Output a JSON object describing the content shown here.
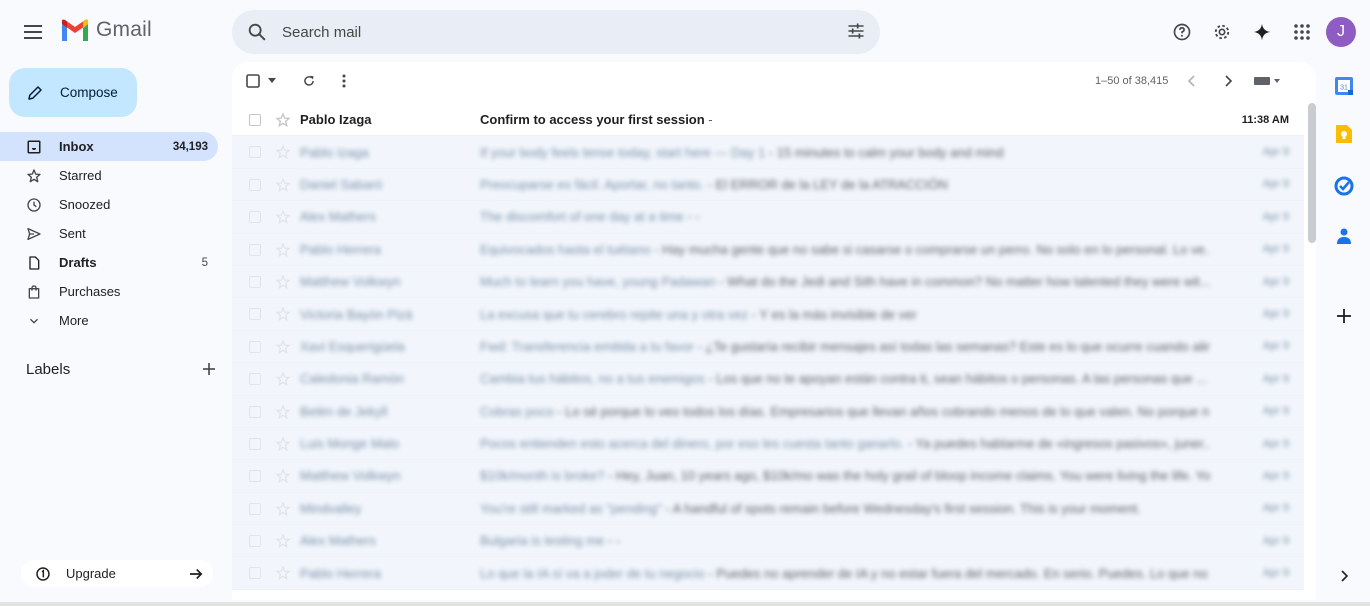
{
  "app": {
    "name": "Gmail"
  },
  "search": {
    "placeholder": "Search mail"
  },
  "user": {
    "initial": "J",
    "avatar_color": "#8e5cc2"
  },
  "compose": {
    "label": "Compose"
  },
  "nav": {
    "items": [
      {
        "label": "Inbox",
        "count": "34,193",
        "icon": "inbox-icon",
        "active": true
      },
      {
        "label": "Starred",
        "count": "",
        "icon": "star-icon"
      },
      {
        "label": "Snoozed",
        "count": "",
        "icon": "clock-icon"
      },
      {
        "label": "Sent",
        "count": "",
        "icon": "send-icon"
      },
      {
        "label": "Drafts",
        "count": "5",
        "icon": "draft-icon"
      },
      {
        "label": "Purchases",
        "count": "",
        "icon": "shopping-bag-icon"
      },
      {
        "label": "More",
        "count": "",
        "icon": "chevron-down-icon"
      }
    ]
  },
  "labels": {
    "heading": "Labels"
  },
  "upgrade": {
    "label": "Upgrade"
  },
  "toolbar": {
    "pagination": "1–50 of 38,415"
  },
  "emails": [
    {
      "sender": "Pablo Izaga",
      "subject": "Confirm to access your first session",
      "snippet": " -",
      "date": "11:38 AM",
      "unread": true,
      "faded": false
    },
    {
      "sender": "Pablo Izaga",
      "subject": "If your body feels tense today, start here — Day 1",
      "snippet": " - 15 minutes to calm your body and mind",
      "date": "Apr 9",
      "unread": false,
      "faded": true
    },
    {
      "sender": "Daniel Sabaró",
      "subject": "Preocuparse es fácil. Aportar, no tanto.",
      "snippet": " - El ERROR de la LEY de la ATRACCIÓN",
      "date": "Apr 9",
      "unread": false,
      "faded": true
    },
    {
      "sender": "Alex Mathers",
      "subject": "The discomfort of one day at a time",
      "snippet": " - -",
      "date": "Apr 9",
      "unread": false,
      "faded": true
    },
    {
      "sender": "Pablo Herrera",
      "subject": "Equivocados hasta el tuétano",
      "snippet": " - Hay mucha gente que no sabe si casarse o comprarse un perro. No solo en lo personal. Lo ve...",
      "date": "Apr 9",
      "unread": false,
      "faded": true
    },
    {
      "sender": "Matthew Volkwyn",
      "subject": "Much to learn you have, young Padawan",
      "snippet": " - What do the Jedi and Sith have in common? No matter how talented they were wit...",
      "date": "Apr 9",
      "unread": false,
      "faded": true
    },
    {
      "sender": "Victoria Bayón Pizá",
      "subject": "La excusa que tu cerebro repite una y otra vez",
      "snippet": " - Y es la más invisible de ver",
      "date": "Apr 9",
      "unread": false,
      "faded": true
    },
    {
      "sender": "Xavi Esquerigüela",
      "subject": "Fwd: Transferencia emitida a tu favor",
      "snippet": " - ¿Te gustaría recibir mensajes así todas las semanas? Este es lo que ocurre cuando alin...",
      "date": "Apr 9",
      "unread": false,
      "faded": true
    },
    {
      "sender": "Caledonia Ramón",
      "subject": "Cambia tus hábitos, no a tus enemigos",
      "snippet": " - Los que no te apoyan están contra ti, sean hábitos o personas. A las personas que ...",
      "date": "Apr 9",
      "unread": false,
      "faded": true
    },
    {
      "sender": "Belén de Jekyll",
      "subject": "Cobras poco",
      "snippet": " - Lo sé porque lo veo todos los días. Empresarios que llevan años cobrando menos de lo que valen. No porque n...",
      "date": "Apr 9",
      "unread": false,
      "faded": true
    },
    {
      "sender": "Luis Monge Malo",
      "subject": "Pocos entienden esto acerca del dinero, por eso les cuesta tanto ganarlo.",
      "snippet": " - Ya puedes hablarme de «ingresos pasivos», juner...",
      "date": "Apr 9",
      "unread": false,
      "faded": true
    },
    {
      "sender": "Matthew Volkwyn",
      "subject": "$10k/month is broke?",
      "snippet": " - Hey, Juan, 10 years ago, $10k/mo was the holy grail of bloop income claims. You were living the life. Yo...",
      "date": "Apr 9",
      "unread": false,
      "faded": true
    },
    {
      "sender": "Mindvalley",
      "subject": "You're still marked as \"pending\"",
      "snippet": " - A handful of spots remain before Wednesday's first session. This is your moment.",
      "date": "Apr 9",
      "unread": false,
      "faded": true
    },
    {
      "sender": "Alex Mathers",
      "subject": "Bulgaria is testing me",
      "snippet": " - -",
      "date": "Apr 9",
      "unread": false,
      "faded": true
    },
    {
      "sender": "Pablo Herrera",
      "subject": "Lo que la IA sí va a joder de tu negocio",
      "snippet": " - Puedes no aprender de IA y no estar fuera del mercado. En serio. Puedes. Lo que no ...",
      "date": "Apr 9",
      "unread": false,
      "faded": true
    }
  ],
  "colors": {
    "accent": "#c2e7ff",
    "active_nav": "#d3e3fd",
    "background": "#f8fafd"
  }
}
